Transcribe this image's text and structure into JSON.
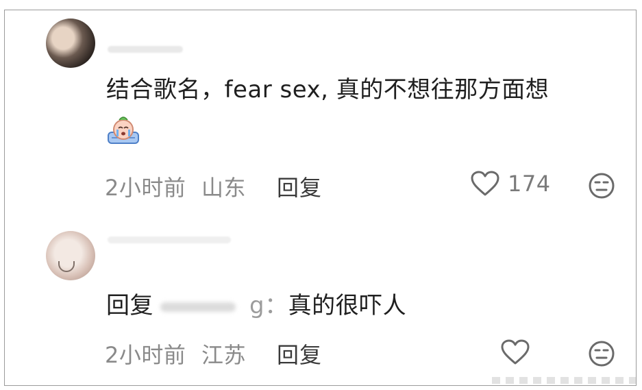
{
  "comments": [
    {
      "text": "结合歌名，fear sex, 真的不想往那方面想",
      "emoji_icon": "crying-emoji-icon",
      "time": "2小时前",
      "location": "山东",
      "reply_label": "回复",
      "likes": "174"
    },
    {
      "reply_prefix": "回复",
      "mention_tail": "g：",
      "text": "真的很吓人",
      "time": "2小时前",
      "location": "江苏",
      "reply_label": "回复"
    }
  ],
  "icons": {
    "like": "heart-outline-icon",
    "reaction": "meh-face-icon"
  },
  "colors": {
    "text": "#1f1f1f",
    "meta": "#8a8a8a",
    "reply": "#3a3a3a",
    "icon": "#666666"
  }
}
